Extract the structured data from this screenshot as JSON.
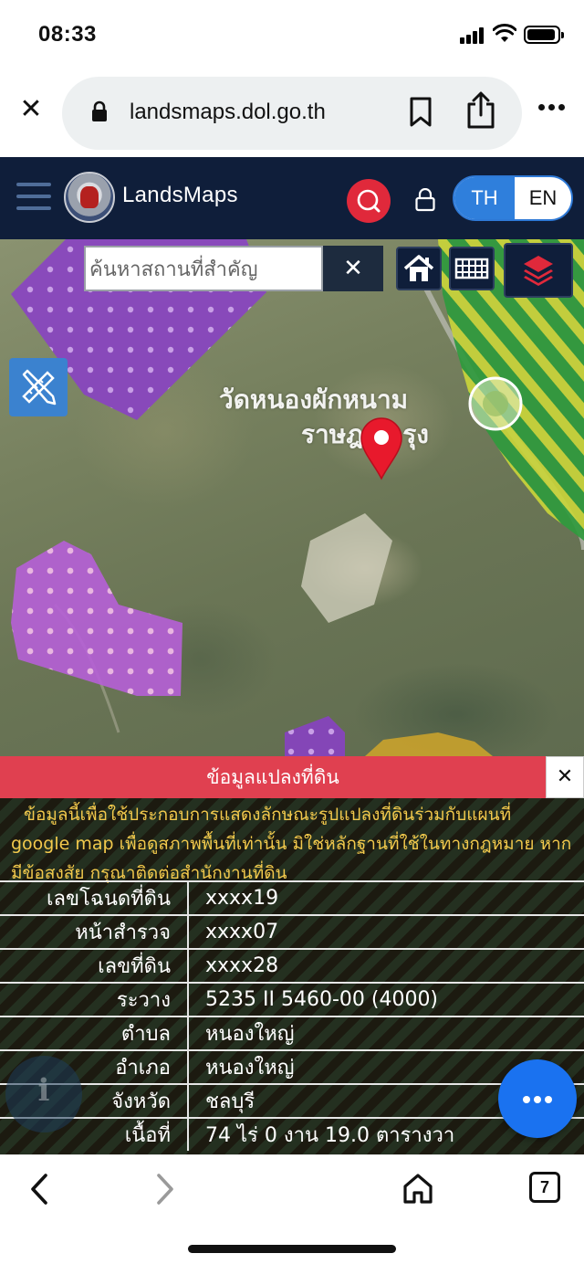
{
  "status_bar": {
    "time": "08:33"
  },
  "browser": {
    "url": "landsmaps.dol.go.th",
    "tab_count": "7"
  },
  "header": {
    "app_title": "LandsMaps",
    "lang_th": "TH",
    "lang_en": "EN",
    "active_lang": "TH"
  },
  "map": {
    "search_placeholder": "ค้นหาสถานที่สำคัญ",
    "search_clear": "✕",
    "place_label_line1": "วัดหนองผักหนาม",
    "place_label_line2": "ราษฎ บำรุง"
  },
  "land_panel": {
    "title": "ข้อมูลแปลงที่ดิน",
    "close": "✕",
    "notice": "ข้อมูลนี้เพื่อใช้ประกอบการแสดงลักษณะรูปแปลงที่ดินร่วมกับแผนที่ google map เพื่อดูสภาพพื้นที่เท่านั้น มิใช่หลักฐานที่ใช้ในทางกฎหมาย หากมีข้อสงสัย กรุณาติดต่อสำนักงานที่ดิน",
    "rows": [
      {
        "label": "เลขโฉนดที่ดิน",
        "value": "xxxx19"
      },
      {
        "label": "หน้าสำรวจ",
        "value": "xxxx07"
      },
      {
        "label": "เลขที่ดิน",
        "value": "xxxx28"
      },
      {
        "label": "ระวาง",
        "value": "5235 II 5460-00 (4000)"
      },
      {
        "label": "ตำบล",
        "value": "หนองใหญ่"
      },
      {
        "label": "อำเภอ",
        "value": "หนองใหญ่"
      },
      {
        "label": "จังหวัด",
        "value": "ชลบุรี"
      },
      {
        "label": "เนื้อที่",
        "value": "74 ไร่ 0 งาน 19.0 ตารางวา"
      }
    ]
  },
  "colors": {
    "header_bg": "#0f1e3a",
    "accent_blue": "#2f7fdc",
    "search_red": "#e0293b",
    "panel_red": "#e04050",
    "notice_yellow": "#f2c94c",
    "fab_blue": "#1a72f0"
  },
  "icons": [
    "close-icon",
    "lock-icon",
    "bookmark-icon",
    "share-icon",
    "more-icon",
    "hamburger-icon",
    "search-icon",
    "padlock-icon",
    "home-icon",
    "grid-icon",
    "layers-icon",
    "ruler-pencil-icon",
    "map-pin-icon",
    "info-icon",
    "chat-icon",
    "back-arrow-icon",
    "forward-arrow-icon"
  ]
}
